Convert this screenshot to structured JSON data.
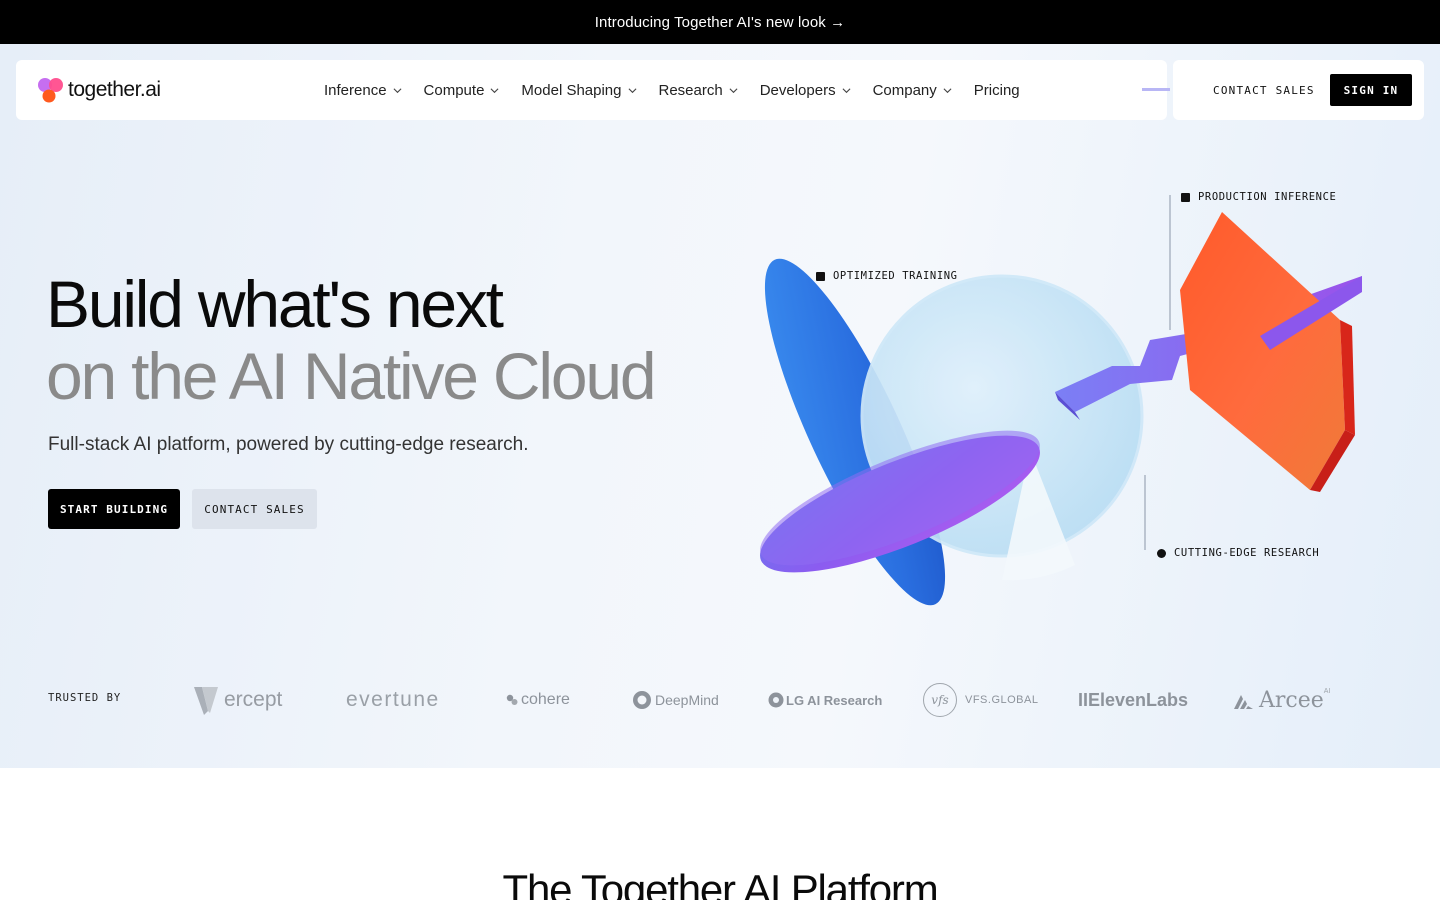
{
  "announcement": {
    "text": "Introducing Together AI's new look →"
  },
  "brand": {
    "name": "together.ai"
  },
  "nav": {
    "items": [
      {
        "label": "Inference",
        "has_dropdown": true
      },
      {
        "label": "Compute",
        "has_dropdown": true
      },
      {
        "label": "Model Shaping",
        "has_dropdown": true
      },
      {
        "label": "Research",
        "has_dropdown": true
      },
      {
        "label": "Developers",
        "has_dropdown": true
      },
      {
        "label": "Company",
        "has_dropdown": true
      },
      {
        "label": "Pricing",
        "has_dropdown": false
      }
    ]
  },
  "header_actions": {
    "contact_sales": "CONTACT SALES",
    "sign_in": "SIGN IN"
  },
  "hero": {
    "title_line1": "Build what's next",
    "title_line2": "on the AI Native Cloud",
    "subtitle": "Full-stack AI platform, powered by cutting-edge research.",
    "cta_primary": "START BUILDING",
    "cta_secondary": "CONTACT SALES",
    "tags": {
      "production": "PRODUCTION INFERENCE",
      "training": "OPTIMIZED TRAINING",
      "research": "CUTTING-EDGE RESEARCH"
    }
  },
  "trusted": {
    "label": "TRUSTED BY",
    "logos": {
      "vercept": "ercept",
      "evertune": "evertune",
      "cohere": "cohere",
      "deepmind": "DeepMind",
      "lg": "LG AI Research",
      "vfs": "VFS.GLOBAL",
      "vfs_mark": "vfs",
      "elevenlabs": "IIElevenLabs",
      "arcee": "Arcee",
      "arcee_sup": "AI"
    }
  },
  "platform": {
    "title": "The Together AI Platform"
  },
  "colors": {
    "background_hero": "#eef3fa",
    "black": "#000000",
    "muted_heading": "#8a8a8a",
    "secondary_button": "#dde3ec",
    "logo_gray": "#8d939b"
  }
}
